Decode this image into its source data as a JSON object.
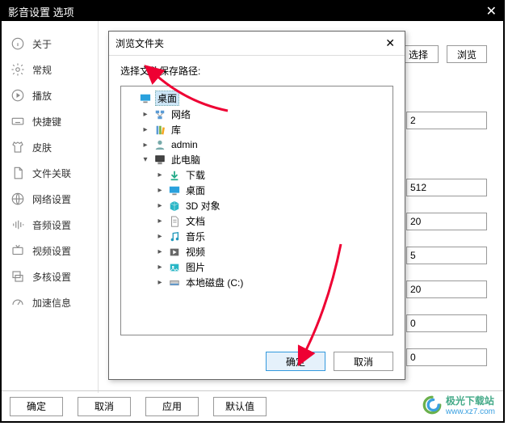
{
  "window_title": "影音设置 选项",
  "sidebar": {
    "items": [
      {
        "label": "关于"
      },
      {
        "label": "常规"
      },
      {
        "label": "播放"
      },
      {
        "label": "快捷键"
      },
      {
        "label": "皮肤"
      },
      {
        "label": "文件关联"
      },
      {
        "label": "网络设置"
      },
      {
        "label": "音频设置"
      },
      {
        "label": "视频设置"
      },
      {
        "label": "多核设置"
      },
      {
        "label": "加速信息"
      }
    ]
  },
  "content": {
    "header_buttons": {
      "select": "选择",
      "browse": "浏览"
    },
    "fields": {
      "v1": "2",
      "v2": "512",
      "v3": "20",
      "v4": "5",
      "v5": "20",
      "v6": "0",
      "v7": "0"
    }
  },
  "bottom": {
    "ok": "确定",
    "cancel": "取消",
    "apply": "应用",
    "defaults": "默认值"
  },
  "dialog": {
    "title": "浏览文件夹",
    "label": "选择文件保存路径:",
    "ok": "确定",
    "cancel": "取消",
    "tree": {
      "desktop": "桌面",
      "network": "网络",
      "libraries": "库",
      "admin": "admin",
      "this_pc": "此电脑",
      "downloads": "下载",
      "desktop2": "桌面",
      "objects3d": "3D 对象",
      "documents": "文档",
      "music": "音乐",
      "videos": "视频",
      "pictures": "图片",
      "local_disk": "本地磁盘 (C:)"
    }
  },
  "watermark": {
    "name": "极光下载站",
    "url": "www.xz7.com"
  }
}
